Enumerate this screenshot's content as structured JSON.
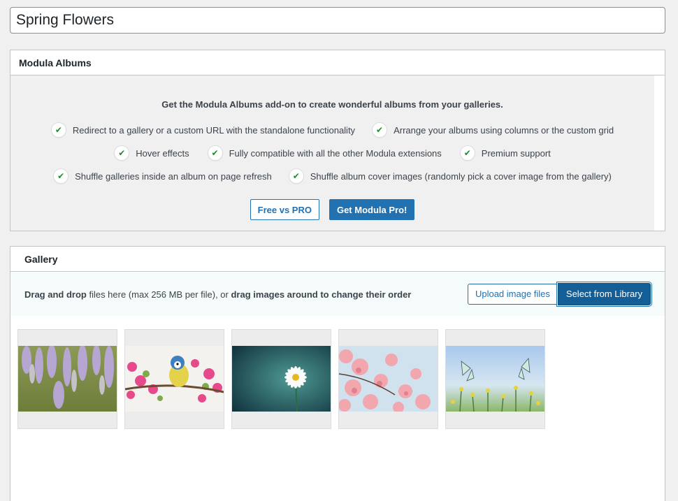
{
  "post_title": "Spring Flowers",
  "albums": {
    "title": "Modula Albums",
    "headline": "Get the Modula Albums add-on to create wonderful albums from your galleries.",
    "features_row1": [
      "Redirect to a gallery or a custom URL with the standalone functionality",
      "Arrange your albums using columns or the custom grid"
    ],
    "features_row2": [
      "Hover effects",
      "Fully compatible with all the other Modula extensions",
      "Premium support"
    ],
    "features_row3": [
      "Shuffle galleries inside an album on page refresh",
      "Shuffle album cover images (randomly pick a cover image from the gallery)"
    ],
    "free_vs_pro_label": "Free vs PRO",
    "get_pro_label": "Get Modula Pro!"
  },
  "gallery": {
    "title": "Gallery",
    "upload_text": {
      "part1": "Drag and drop",
      "part2": " files here (max 256 MB per file), or ",
      "part3": "drag images around to change their order"
    },
    "upload_label": "Upload image files",
    "library_label": "Select from Library",
    "thumbnails": [
      {
        "subject": "wisteria"
      },
      {
        "subject": "bird-on-blossom"
      },
      {
        "subject": "daisy"
      },
      {
        "subject": "cherry-blossom"
      },
      {
        "subject": "butterflies"
      }
    ]
  },
  "colors": {
    "accent": "#2271b1",
    "accent_dark": "#135e96",
    "check": "#1e8c28"
  }
}
